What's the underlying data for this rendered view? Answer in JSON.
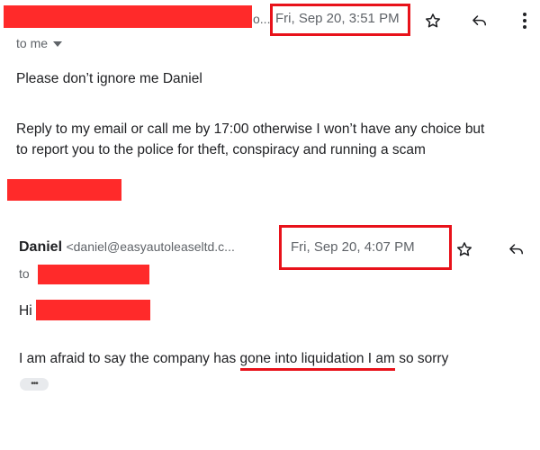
{
  "msg1": {
    "sender_ellipsis": "o...",
    "date": "Fri, Sep 20, 3:51 PM",
    "to_line": "to me",
    "body_line1": "Please don’t ignore me Daniel",
    "body_line2": "Reply to my email or call me by 17:00 otherwise I won’t have any choice but",
    "body_line3": "to report you to the police for theft, conspiracy and running a scam"
  },
  "msg2": {
    "sender_name": "Daniel",
    "sender_email": "<daniel@easyautoleaseltd.c...",
    "date": "Fri, Sep 20, 4:07 PM",
    "to_label": "to",
    "greeting": "Hi",
    "body_before": "I am afraid to say the company has ",
    "body_underlined": "gone into liquidation I am",
    "body_after": " so sorry",
    "more_label": "•••"
  },
  "icons": {
    "star": "star-icon",
    "reply": "reply-icon",
    "more": "more-vert-icon",
    "dropdown": "caret-down-icon"
  },
  "colors": {
    "redaction": "#ff2a2a",
    "highlight": "#e8121a",
    "muted": "#5f6368",
    "text": "#202124"
  }
}
